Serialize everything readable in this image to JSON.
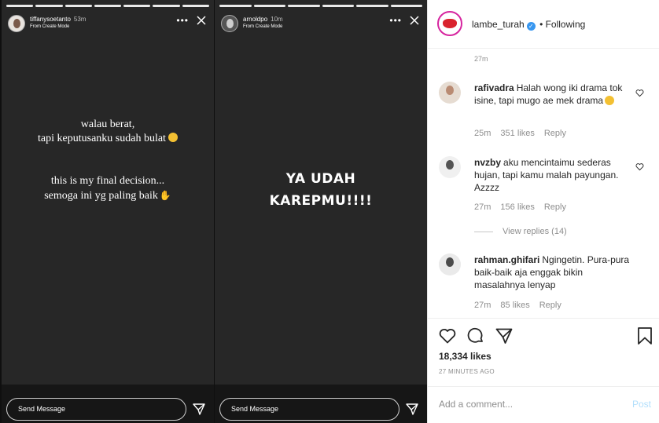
{
  "stories": [
    {
      "username": "tiffanysoetanto",
      "time": "53m",
      "subtitle": "From Create Mode",
      "text_lines_1": [
        "walau berat,",
        "tapi keputusanku sudah bulat"
      ],
      "text_lines_2": [
        "this is my final decision...",
        "semoga ini yg paling baik"
      ],
      "send_placeholder": "Send Message",
      "progress_segments": 7,
      "progress_done": 7
    },
    {
      "username": "arnoldpo",
      "time": "10m",
      "subtitle": "From Create Mode",
      "big_lines": [
        "YA UDAH",
        "KAREPMU!!!!"
      ],
      "send_placeholder": "Send Message",
      "progress_segments": 6,
      "progress_done": 6
    }
  ],
  "post": {
    "username": "lambe_turah",
    "follow_status": "• Following",
    "top_time": "27m",
    "comments": [
      {
        "user": "rafivadra",
        "text": "Halah wong iki drama tok isine, tapi mugo ae mek drama",
        "time": "25m",
        "likes": "351 likes",
        "reply": "Reply"
      },
      {
        "user": "nvzby",
        "text": "aku mencintaimu sederas hujan, tapi kamu malah payungan. Azzzz",
        "time": "27m",
        "likes": "156 likes",
        "reply": "Reply"
      },
      {
        "user": "rahman.ghifari",
        "text": "Ngingetin. Pura-pura baik-baik aja enggak bikin masalahnya lenyap",
        "time": "27m",
        "likes": "85 likes",
        "reply": "Reply"
      }
    ],
    "view_replies": "View replies (14)",
    "likes": "18,334 likes",
    "time_ago": "27 MINUTES AGO",
    "add_comment_placeholder": "Add a comment...",
    "post_label": "Post"
  },
  "colors": {
    "story_bg": "#272727",
    "link_muted": "#8e8e8e",
    "post_button_disabled": "#b2dffc",
    "verified_blue": "#3897f0"
  }
}
